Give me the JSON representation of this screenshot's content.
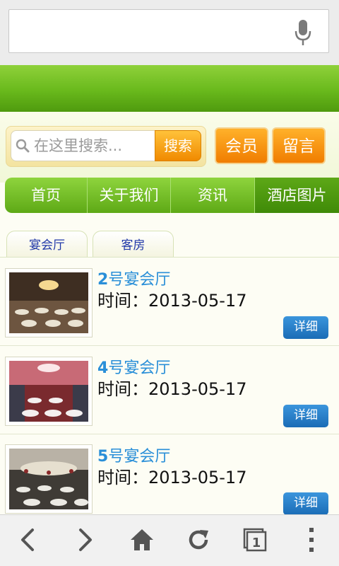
{
  "search": {
    "placeholder": "在这里搜索...",
    "button": "搜索"
  },
  "top_buttons": {
    "member": "会员",
    "message": "留言"
  },
  "nav": [
    "首页",
    "关于我们",
    "资讯",
    "酒店图片"
  ],
  "sub_tabs": [
    "宴会厅",
    "客房"
  ],
  "items": [
    {
      "num": "2",
      "name": "号宴会厅",
      "time": "时间：2013-05-17",
      "button": "详细"
    },
    {
      "num": "4",
      "name": "号宴会厅",
      "time": "时间：2013-05-17",
      "button": "详细"
    },
    {
      "num": "5",
      "name": "号宴会厅",
      "time": "时间：2013-05-17",
      "button": "详细"
    }
  ],
  "colors": {
    "header_green": "#69b91c",
    "accent_orange": "#f08a00",
    "link_blue": "#2a8fd8",
    "button_blue": "#1a6cb6"
  },
  "toolbar_icons": [
    "back-icon",
    "forward-icon",
    "home-icon",
    "reload-icon",
    "tabs-icon",
    "menu-icon"
  ],
  "tabs_count": "1"
}
